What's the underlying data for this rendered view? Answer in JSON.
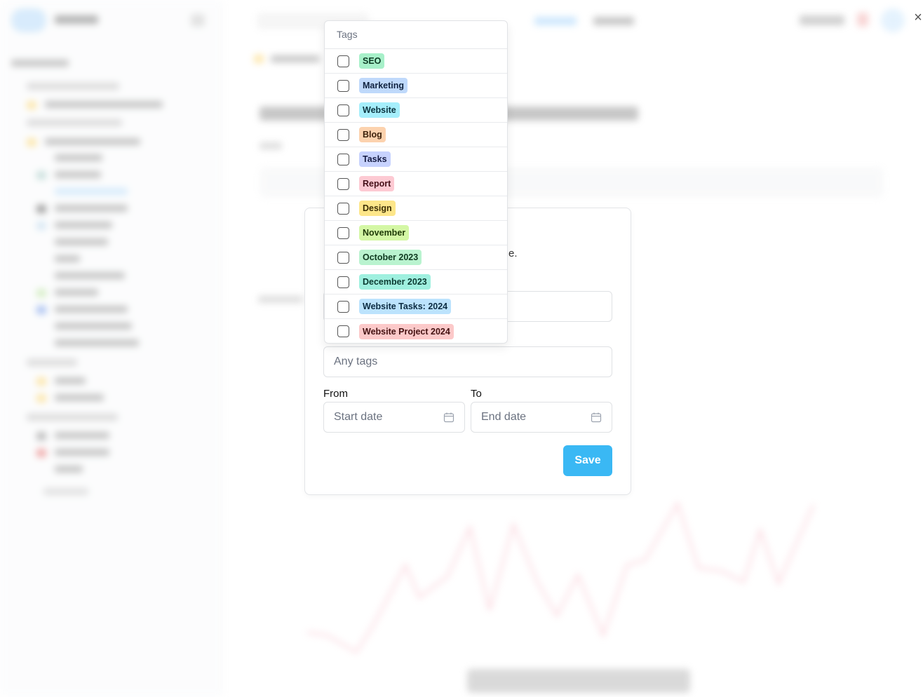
{
  "window": {
    "close_label": "×"
  },
  "modal": {
    "desc_fragment": "e.",
    "tags_placeholder": "Any tags",
    "from_label": "From",
    "to_label": "To",
    "start_placeholder": "Start date",
    "end_placeholder": "End date",
    "save_label": "Save",
    "accent_color": "#3ab8f4"
  },
  "tags_dropdown": {
    "header": "Tags",
    "items": [
      {
        "label": "SEO",
        "bg": "#a7f0c9",
        "fg": "#0d3a24",
        "checked": false
      },
      {
        "label": "Marketing",
        "bg": "#bfd9fb",
        "fg": "#10233f",
        "checked": false
      },
      {
        "label": "Website",
        "bg": "#a5eefb",
        "fg": "#0b3440",
        "checked": false
      },
      {
        "label": "Blog",
        "bg": "#fcd2ae",
        "fg": "#3d220c",
        "checked": false
      },
      {
        "label": "Tasks",
        "bg": "#c7d2fd",
        "fg": "#161c44",
        "checked": false
      },
      {
        "label": "Report",
        "bg": "#fdcad3",
        "fg": "#451019",
        "checked": false
      },
      {
        "label": "Design",
        "bg": "#fde68a",
        "fg": "#3d2f05",
        "checked": false
      },
      {
        "label": "November",
        "bg": "#d4f7a5",
        "fg": "#1f3a07",
        "checked": false
      },
      {
        "label": "October 2023",
        "bg": "#b9f3cf",
        "fg": "#0f3a20",
        "checked": false
      },
      {
        "label": "December 2023",
        "bg": "#9ff0df",
        "fg": "#0b3a31",
        "checked": false
      },
      {
        "label": "Website Tasks: 2024",
        "bg": "#bce3fd",
        "fg": "#0c2c42",
        "checked": false
      },
      {
        "label": "Website Project 2024",
        "bg": "#fcc9c9",
        "fg": "#431111",
        "checked": false
      }
    ]
  }
}
